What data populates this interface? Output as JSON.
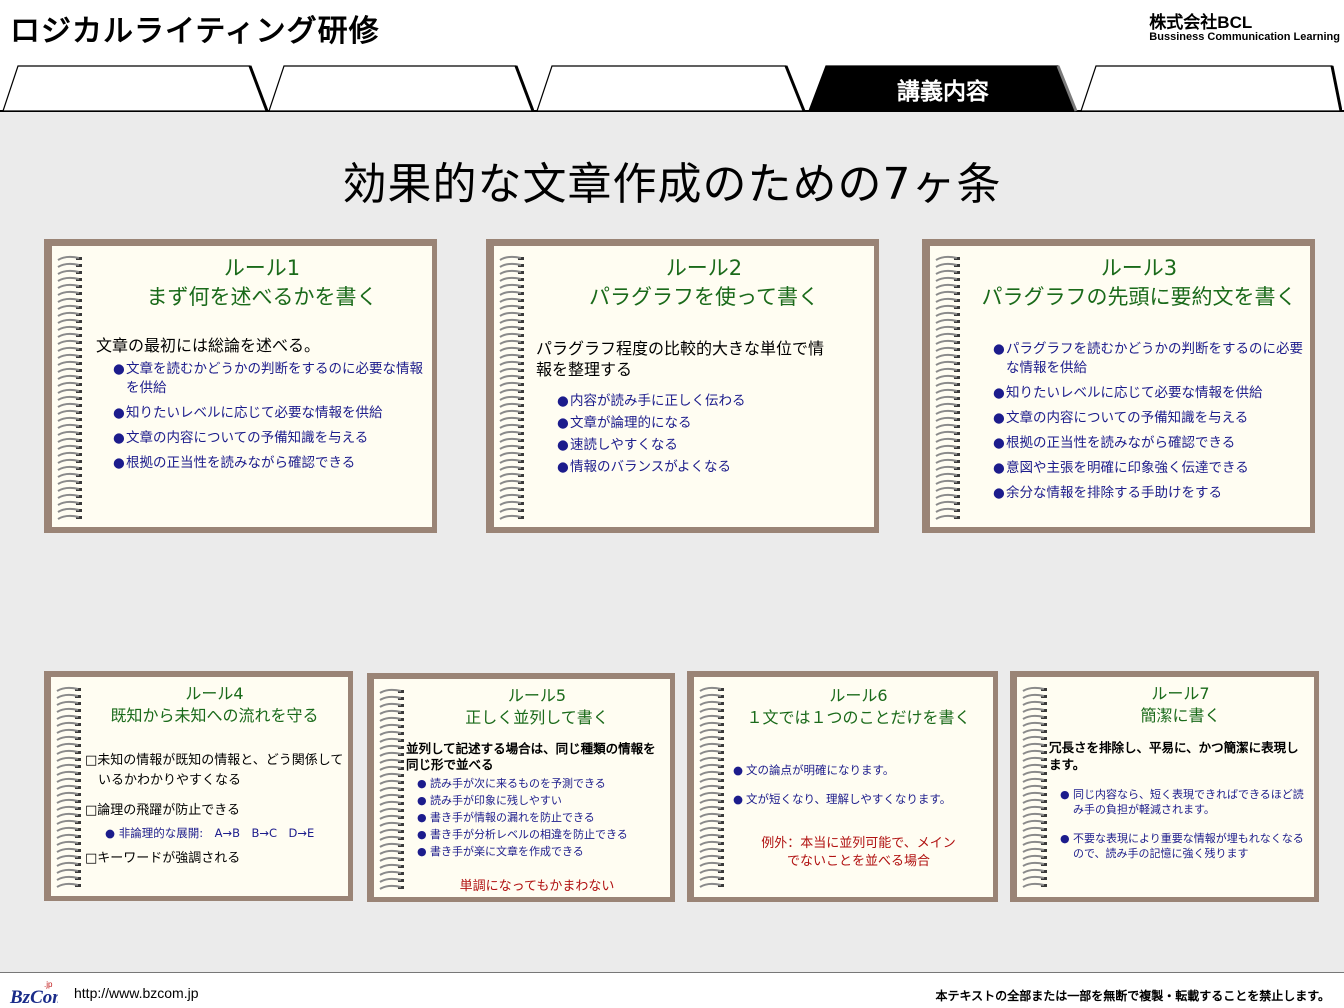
{
  "header": {
    "course_title": "ロジカルライティング研修",
    "company_name": "株式会社BCL",
    "company_sub": "Bussiness Communication Learning"
  },
  "tabs": [
    {
      "label": ""
    },
    {
      "label": ""
    },
    {
      "label": ""
    },
    {
      "label": "講義内容",
      "active": true
    },
    {
      "label": ""
    }
  ],
  "main_title": "効果的な文章作成のための7ヶ条",
  "rules": [
    {
      "title1": "ルール1",
      "title2": "まず何を述べるかを書く",
      "lead": "文章の最初には総論を述べる。",
      "bullets": [
        "文章を読むかどうかの判断をするのに必要な情報を供給",
        "知りたいレベルに応じて必要な情報を供給",
        "文章の内容についての予備知識を与える",
        "根拠の正当性を読みながら確認できる"
      ]
    },
    {
      "title1": "ルール2",
      "title2": "パラグラフを使って書く",
      "lead": "パラグラフ程度の比較的大きな単位で情報を整理する",
      "bullets": [
        "内容が読み手に正しく伝わる",
        "文章が論理的になる",
        "速読しやすくなる",
        "情報のバランスがよくなる"
      ]
    },
    {
      "title1": "ルール3",
      "title2": "パラグラフの先頭に要約文を書く",
      "bullets": [
        "パラグラフを読むかどうかの判断をするのに必要な情報を供給",
        "知りたいレベルに応じて必要な情報を供給",
        "文章の内容についての予備知識を与える",
        "根拠の正当性を読みながら確認できる",
        "意図や主張を明確に印象強く伝達できる",
        "余分な情報を排除する手助けをする"
      ]
    },
    {
      "title1": "ルール4",
      "title2": "既知から未知への流れを守る",
      "items": [
        "□未知の情報が既知の情報と、どう関係しているかわかりやすくなる",
        "□論理の飛躍が防止できる",
        "□キーワードが強調される"
      ],
      "sub_bullet": "非論理的な展開:　A→B　B→C　D→E"
    },
    {
      "title1": "ルール5",
      "title2": "正しく並列して書く",
      "lead": "並列して記述する場合は、同じ種類の情報を同じ形で並べる",
      "bullets": [
        "読み手が次に来るものを予測できる",
        "読み手が印象に残しやすい",
        "書き手が情報の漏れを防止できる",
        "書き手が分析レベルの相違を防止できる",
        "書き手が楽に文章を作成できる"
      ],
      "note": "単調になってもかまわない"
    },
    {
      "title1": "ルール6",
      "title2": "１文では１つのことだけを書く",
      "bullets": [
        "文の論点が明確になります。",
        "文が短くなり、理解しやすくなります。"
      ],
      "note1": "例外：本当に並列可能で、メイン",
      "note2": "でないことを並べる場合"
    },
    {
      "title1": "ルール7",
      "title2": "簡潔に書く",
      "lead": "冗長さを排除し、平易に、かつ簡潔に表現します。",
      "bullets": [
        "同じ内容なら、短く表現できればできるほど読み手の負担が軽減されます。",
        "不要な表現により重要な情報が埋もれなくなるので、読み手の記憶に強く残ります"
      ]
    }
  ],
  "footer": {
    "logo_text": "BzCom",
    "logo_sup": ".jp",
    "url": "http://www.bzcom.jp",
    "copyright": "本テキストの全部または一部を無断で複製・転載することを禁止します。"
  },
  "colors": {
    "card_frame": "#9a8476",
    "card_page": "#fffdf2",
    "title_green": "#1a6a1a",
    "bullet_blue": "#1c1c8c",
    "note_red": "#b01010",
    "background": "#ebebeb"
  }
}
